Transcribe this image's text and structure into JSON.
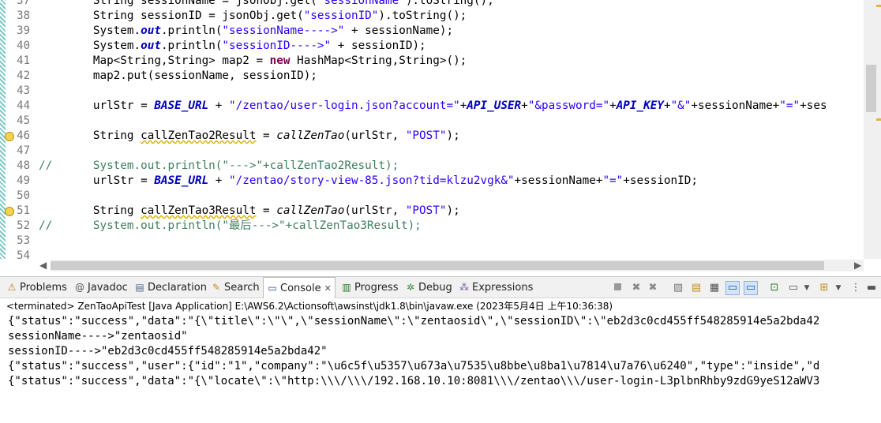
{
  "editor": {
    "line_numbers": [
      "37",
      "38",
      "39",
      "40",
      "41",
      "42",
      "43",
      "44",
      "45",
      "46",
      "47",
      "48",
      "49",
      "50",
      "51",
      "52",
      "53",
      "54"
    ],
    "lines": [
      [
        {
          "t": "        String sessionName = jsonObj.get("
        },
        {
          "t": "\"sessionName\"",
          "c": "st"
        },
        {
          "t": ").toString();"
        }
      ],
      [
        {
          "t": "        String sessionID = jsonObj.get("
        },
        {
          "t": "\"sessionID\"",
          "c": "st"
        },
        {
          "t": ").toString();"
        }
      ],
      [
        {
          "t": "        System."
        },
        {
          "t": "out",
          "c": "fld"
        },
        {
          "t": ".println("
        },
        {
          "t": "\"sessionName---->\"",
          "c": "st"
        },
        {
          "t": " + sessionName);"
        }
      ],
      [
        {
          "t": "        System."
        },
        {
          "t": "out",
          "c": "fld"
        },
        {
          "t": ".println("
        },
        {
          "t": "\"sessionID---->\"",
          "c": "st"
        },
        {
          "t": " + sessionID);"
        }
      ],
      [
        {
          "t": "        Map<String,String> map2 = "
        },
        {
          "t": "new",
          "c": "kw"
        },
        {
          "t": " HashMap<String,String>();"
        }
      ],
      [
        {
          "t": "        map2.put(sessionName, sessionID);"
        }
      ],
      [
        {
          "t": ""
        }
      ],
      [
        {
          "t": "        urlStr = "
        },
        {
          "t": "BASE_URL",
          "c": "fld"
        },
        {
          "t": " + "
        },
        {
          "t": "\"/zentao/user-login.json?account=\"",
          "c": "st"
        },
        {
          "t": "+"
        },
        {
          "t": "API_USER",
          "c": "fld"
        },
        {
          "t": "+"
        },
        {
          "t": "\"&password=\"",
          "c": "st"
        },
        {
          "t": "+"
        },
        {
          "t": "API_KEY",
          "c": "fld"
        },
        {
          "t": "+"
        },
        {
          "t": "\"&\"",
          "c": "st"
        },
        {
          "t": "+sessionName+"
        },
        {
          "t": "\"=\"",
          "c": "st"
        },
        {
          "t": "+ses"
        }
      ],
      [
        {
          "t": ""
        }
      ],
      [
        {
          "t": "        String "
        },
        {
          "t": "callZenTao2Result",
          "c": "warn-var"
        },
        {
          "t": " = "
        },
        {
          "t": "callZenTao",
          "c": "sf"
        },
        {
          "t": "(urlStr, "
        },
        {
          "t": "\"POST\"",
          "c": "st"
        },
        {
          "t": ");"
        }
      ],
      [
        {
          "t": ""
        }
      ],
      [
        {
          "t": "//      System.out.println(\"--->\"+callZenTao2Result);",
          "c": "cm"
        }
      ],
      [
        {
          "t": "        urlStr = "
        },
        {
          "t": "BASE_URL",
          "c": "fld"
        },
        {
          "t": " + "
        },
        {
          "t": "\"/zentao/story-view-85.json?tid=klzu2vgk&\"",
          "c": "st"
        },
        {
          "t": "+sessionName+"
        },
        {
          "t": "\"=\"",
          "c": "st"
        },
        {
          "t": "+sessionID;"
        }
      ],
      [
        {
          "t": ""
        }
      ],
      [
        {
          "t": "        String "
        },
        {
          "t": "callZenTao3Result",
          "c": "warn-var"
        },
        {
          "t": " = "
        },
        {
          "t": "callZenTao",
          "c": "sf"
        },
        {
          "t": "(urlStr, "
        },
        {
          "t": "\"POST\"",
          "c": "st"
        },
        {
          "t": ");"
        }
      ],
      [
        {
          "t": "//      System.out.println(\"最后--->\"+callZenTao3Result);",
          "c": "cm"
        }
      ],
      [
        {
          "t": ""
        }
      ],
      [
        {
          "t": ""
        }
      ]
    ]
  },
  "views": {
    "tabs": [
      {
        "label": "Problems",
        "icon": "⚠",
        "name": "problems"
      },
      {
        "label": "Javadoc",
        "icon": "@",
        "name": "javadoc"
      },
      {
        "label": "Declaration",
        "icon": "▤",
        "name": "declaration"
      },
      {
        "label": "Search",
        "icon": "✎",
        "name": "search"
      },
      {
        "label": "Console",
        "icon": "▭",
        "name": "console",
        "active": true
      },
      {
        "label": "Progress",
        "icon": "▥",
        "name": "progress"
      },
      {
        "label": "Debug",
        "icon": "✲",
        "name": "debug"
      },
      {
        "label": "Expressions",
        "icon": "⁂",
        "name": "expressions"
      }
    ],
    "close_glyph": "✕"
  },
  "console": {
    "status": "<terminated> ZenTaoApiTest [Java Application] E:\\AWS6.2\\Actionsoft\\awsinst\\jdk1.8\\bin\\javaw.exe (2023年5月4日 上午10:36:38)",
    "lines": [
      "{\"status\":\"success\",\"data\":\"{\\\"title\\\":\\\"\\\",\\\"sessionName\\\":\\\"zentaosid\\\",\\\"sessionID\\\":\\\"eb2d3c0cd455ff548285914e5a2bda42",
      "sessionName---->\"zentaosid\"",
      "sessionID---->\"eb2d3c0cd455ff548285914e5a2bda42\"",
      "{\"status\":\"success\",\"user\":{\"id\":\"1\",\"company\":\"\\u6c5f\\u5357\\u673a\\u7535\\u8bbe\\u8ba1\\u7814\\u7a76\\u6240\",\"type\":\"inside\",\"d",
      "{\"status\":\"success\",\"data\":\"{\\\"locate\\\":\\\"http:\\\\\\/\\\\\\/192.168.10.10:8081\\\\\\/zentao\\\\\\/user-login-L3plbnRhby9zdG9yeS12aWV3"
    ]
  },
  "colors": {
    "ruler": "#7ec8c4",
    "keyword": "#7f0055",
    "string": "#2a00ff",
    "field": "#0000c0",
    "comment": "#3f7f5f"
  }
}
